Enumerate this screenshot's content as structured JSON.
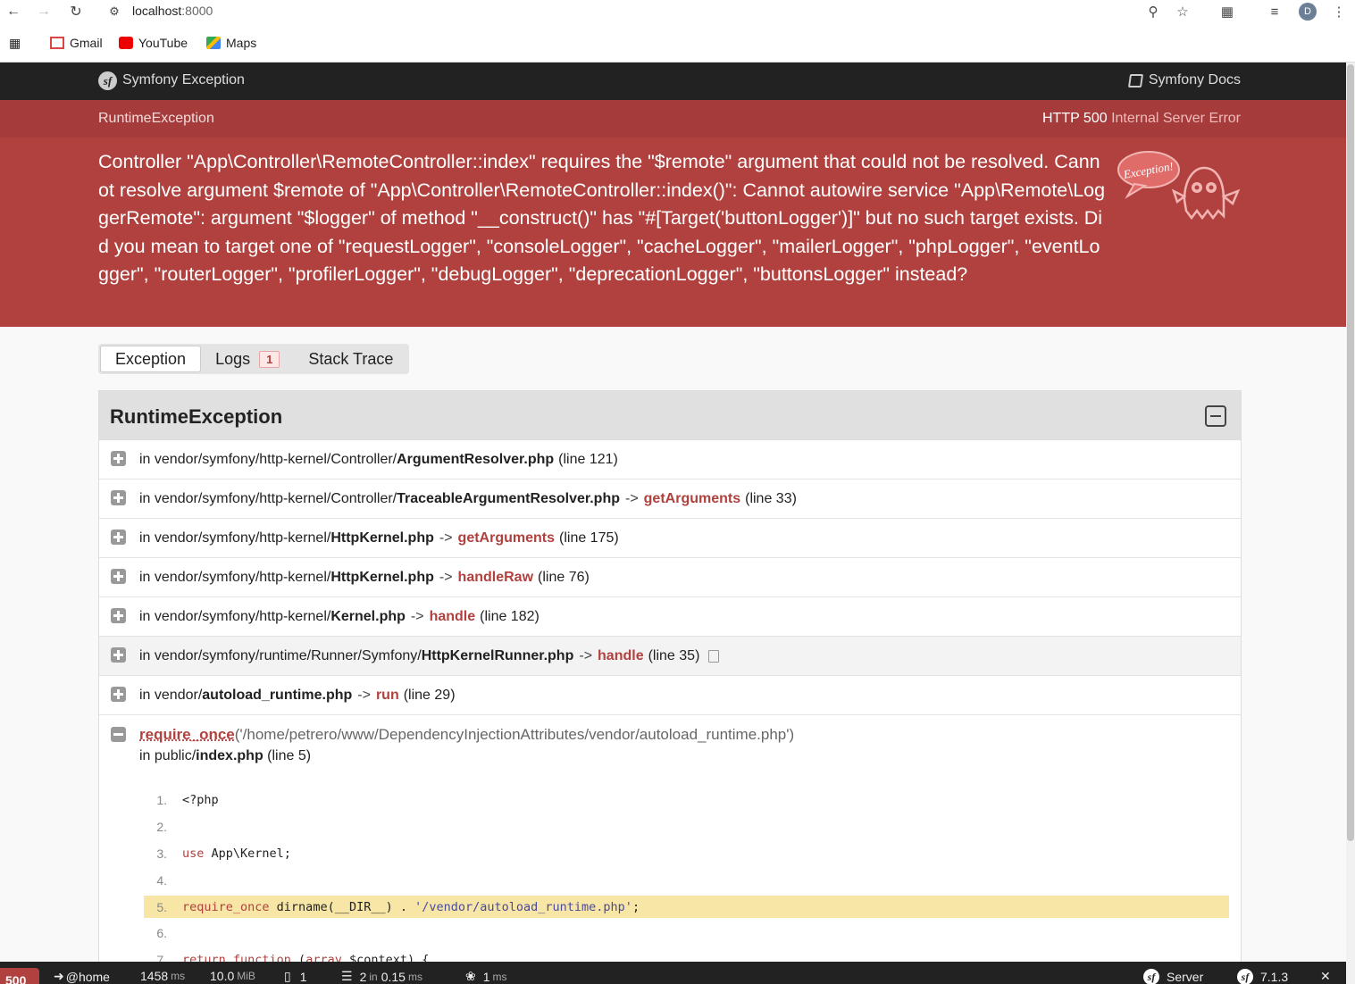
{
  "browser": {
    "url_host": "localhost",
    "url_port": ":8000",
    "avatar_letter": "D",
    "bookmarks": [
      {
        "label": "Gmail",
        "icon": "gmail-icon"
      },
      {
        "label": "YouTube",
        "icon": "youtube-icon"
      },
      {
        "label": "Maps",
        "icon": "maps-icon"
      }
    ]
  },
  "header": {
    "title": "Symfony Exception",
    "docs_label": "Symfony Docs"
  },
  "exception": {
    "class": "RuntimeException",
    "http_code": "HTTP 500",
    "http_text": "Internal Server Error",
    "message": "Controller \"App\\Controller\\RemoteController::index\" requires the \"$remote\" argument that could not be resolved. Cannot resolve argument $remote of \"App\\Controller\\RemoteController::index()\": Cannot autowire service \"App\\Remote\\LoggerRemote\": argument \"$logger\" of method \"__construct()\" has \"#[Target('buttonLogger')]\" but no such target exists. Did you mean to target one of \"requestLogger\", \"consoleLogger\", \"cacheLogger\", \"mailerLogger\", \"phpLogger\", \"eventLogger\", \"routerLogger\", \"profilerLogger\", \"debugLogger\", \"deprecationLogger\", \"buttonsLogger\" instead?",
    "ghost_text": "Exception!"
  },
  "tabs": [
    {
      "label": "Exception",
      "active": true
    },
    {
      "label": "Logs",
      "count": "1"
    },
    {
      "label": "Stack Trace"
    }
  ],
  "trace": {
    "title": "RuntimeException",
    "rows": [
      {
        "path": "in vendor/symfony/http-kernel/Controller/",
        "file": "ArgumentResolver.php",
        "func": "",
        "line": "(line 121)"
      },
      {
        "path": "in vendor/symfony/http-kernel/Controller/",
        "file": "TraceableArgumentResolver.php",
        "func": "getArguments",
        "line": "(line 33)"
      },
      {
        "path": "in vendor/symfony/http-kernel/",
        "file": "HttpKernel.php",
        "func": "getArguments",
        "line": "(line 175)"
      },
      {
        "path": "in vendor/symfony/http-kernel/",
        "file": "HttpKernel.php",
        "func": "handleRaw",
        "line": "(line 76)"
      },
      {
        "path": "in vendor/symfony/http-kernel/",
        "file": "Kernel.php",
        "func": "handle",
        "line": "(line 182)"
      },
      {
        "path": "in vendor/symfony/runtime/Runner/Symfony/",
        "file": "HttpKernelRunner.php",
        "func": "handle",
        "line": "(line 35)"
      },
      {
        "path": "in vendor/",
        "file": "autoload_runtime.php",
        "func": "run",
        "line": "(line 29)"
      }
    ],
    "arrow": "->",
    "expanded": {
      "func": "require_once",
      "args": "('/home/petrero/www/DependencyInjectionAttributes/vendor/autoload_runtime.php')",
      "path": "in public/",
      "file": "index.php",
      "line": "(line 5)"
    },
    "code": [
      {
        "num": "1",
        "parts": [
          {
            "t": "<?php",
            "c": ""
          }
        ]
      },
      {
        "num": "2",
        "parts": []
      },
      {
        "num": "3",
        "parts": [
          {
            "t": "use",
            "c": "k"
          },
          {
            "t": " App\\Kernel;",
            "c": ""
          }
        ]
      },
      {
        "num": "4",
        "parts": []
      },
      {
        "num": "5",
        "hl": true,
        "parts": [
          {
            "t": "require_once",
            "c": "k"
          },
          {
            "t": " dirname(__DIR__) . ",
            "c": ""
          },
          {
            "t": "'/vendor/autoload_runtime.php'",
            "c": "s"
          },
          {
            "t": ";",
            "c": ""
          }
        ]
      },
      {
        "num": "6",
        "parts": []
      },
      {
        "num": "7",
        "parts": [
          {
            "t": "return function",
            "c": "k"
          },
          {
            "t": " (",
            "c": ""
          },
          {
            "t": "array",
            "c": "k"
          },
          {
            "t": " $context) {",
            "c": ""
          }
        ]
      }
    ]
  },
  "toolbar": {
    "status": "500",
    "route": "@home",
    "time_value": "1458",
    "time_unit": "ms",
    "memory_value": "10.0",
    "memory_unit": "MiB",
    "logs": "1",
    "cache_value": "2",
    "cache_in": "in",
    "cache_time": "0.15",
    "cache_unit": "ms",
    "twig_value": "1",
    "twig_unit": "ms",
    "server_label": "Server",
    "version": "7.1.3",
    "close": "✕"
  }
}
